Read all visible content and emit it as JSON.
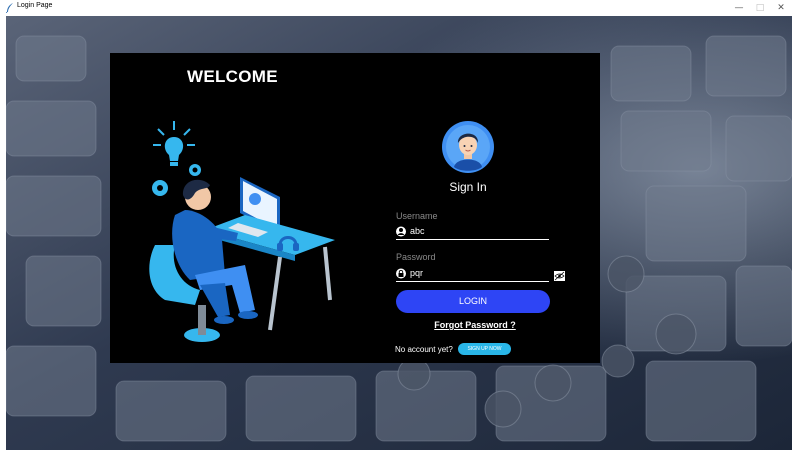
{
  "window": {
    "title": "Login Page",
    "minimize_glyph": "—",
    "maximize_glyph": "□",
    "close_glyph": "✕"
  },
  "card": {
    "welcome": "WELCOME",
    "heading": "Sign In",
    "username": {
      "label": "Username",
      "value": "abc",
      "icon": "user-icon"
    },
    "password": {
      "label": "Password",
      "value": "pqr",
      "icon": "lock-icon",
      "toggle_icon": "show-password-icon"
    },
    "login_label": "LOGIN",
    "forgot_label": "Forgot Password ?",
    "no_account_label": "No account yet?",
    "signup_label": "SIGN UP NOW"
  },
  "colors": {
    "card_bg": "#000000",
    "login_button": "#2e45f5",
    "signup_button": "#29b6e8",
    "avatar_circle": "#3f8ff2",
    "illustration_blue": "#36b7ee"
  }
}
